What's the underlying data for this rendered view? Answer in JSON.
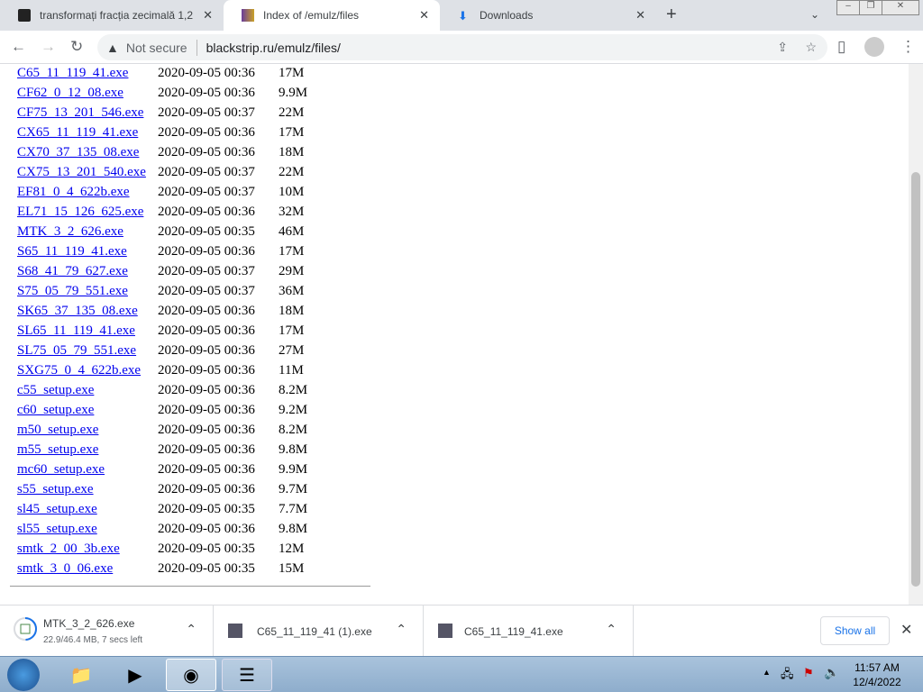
{
  "tabs": [
    {
      "title": "transformați fracția zecimală 1,2",
      "active": false
    },
    {
      "title": "Index of /emulz/files",
      "active": true
    },
    {
      "title": "Downloads",
      "active": false
    }
  ],
  "toolbar": {
    "security": "Not secure",
    "url": "blackstrip.ru/emulz/files/"
  },
  "files": [
    {
      "name": "C65_11_119_41.exe",
      "date": "2020-09-05 00:36",
      "size": "17M"
    },
    {
      "name": "CF62_0_12_08.exe",
      "date": "2020-09-05 00:36",
      "size": "9.9M"
    },
    {
      "name": "CF75_13_201_546.exe",
      "date": "2020-09-05 00:37",
      "size": "22M"
    },
    {
      "name": "CX65_11_119_41.exe",
      "date": "2020-09-05 00:36",
      "size": "17M"
    },
    {
      "name": "CX70_37_135_08.exe",
      "date": "2020-09-05 00:36",
      "size": "18M"
    },
    {
      "name": "CX75_13_201_540.exe",
      "date": "2020-09-05 00:37",
      "size": "22M"
    },
    {
      "name": "EF81_0_4_622b.exe",
      "date": "2020-09-05 00:37",
      "size": "10M"
    },
    {
      "name": "EL71_15_126_625.exe",
      "date": "2020-09-05 00:36",
      "size": "32M"
    },
    {
      "name": "MTK_3_2_626.exe",
      "date": "2020-09-05 00:35",
      "size": "46M"
    },
    {
      "name": "S65_11_119_41.exe",
      "date": "2020-09-05 00:36",
      "size": "17M"
    },
    {
      "name": "S68_41_79_627.exe",
      "date": "2020-09-05 00:37",
      "size": "29M"
    },
    {
      "name": "S75_05_79_551.exe",
      "date": "2020-09-05 00:37",
      "size": "36M"
    },
    {
      "name": "SK65_37_135_08.exe",
      "date": "2020-09-05 00:36",
      "size": "18M"
    },
    {
      "name": "SL65_11_119_41.exe",
      "date": "2020-09-05 00:36",
      "size": "17M"
    },
    {
      "name": "SL75_05_79_551.exe",
      "date": "2020-09-05 00:36",
      "size": "27M"
    },
    {
      "name": "SXG75_0_4_622b.exe",
      "date": "2020-09-05 00:36",
      "size": "11M"
    },
    {
      "name": "c55_setup.exe",
      "date": "2020-09-05 00:36",
      "size": "8.2M"
    },
    {
      "name": "c60_setup.exe",
      "date": "2020-09-05 00:36",
      "size": "9.2M"
    },
    {
      "name": "m50_setup.exe",
      "date": "2020-09-05 00:36",
      "size": "8.2M"
    },
    {
      "name": "m55_setup.exe",
      "date": "2020-09-05 00:36",
      "size": "9.8M"
    },
    {
      "name": "mc60_setup.exe",
      "date": "2020-09-05 00:36",
      "size": "9.9M"
    },
    {
      "name": "s55_setup.exe",
      "date": "2020-09-05 00:36",
      "size": "9.7M"
    },
    {
      "name": "sl45_setup.exe",
      "date": "2020-09-05 00:35",
      "size": "7.7M"
    },
    {
      "name": "sl55_setup.exe",
      "date": "2020-09-05 00:36",
      "size": "9.8M"
    },
    {
      "name": "smtk_2_00_3b.exe",
      "date": "2020-09-05 00:35",
      "size": "12M"
    },
    {
      "name": "smtk_3_0_06.exe",
      "date": "2020-09-05 00:35",
      "size": "15M"
    }
  ],
  "downloads": [
    {
      "name": "MTK_3_2_626.exe",
      "status": "22.9/46.4 MB, 7 secs left",
      "progress": 0.49
    },
    {
      "name": "C65_11_119_41 (1).exe"
    },
    {
      "name": "C65_11_119_41.exe"
    }
  ],
  "download_bar": {
    "show_all": "Show all"
  },
  "clock": {
    "time": "11:57 AM",
    "date": "12/4/2022"
  }
}
